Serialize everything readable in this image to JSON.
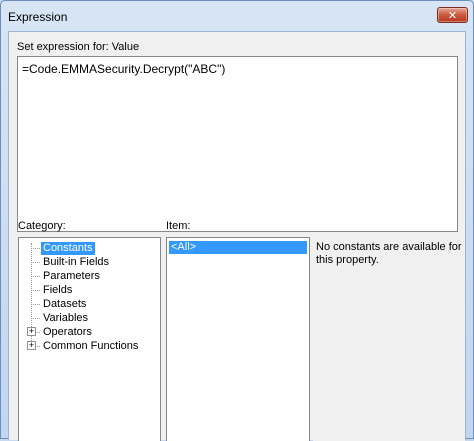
{
  "window": {
    "title": "Expression",
    "close_symbol": "✕"
  },
  "expression": {
    "label": "Set expression for: Value",
    "value": "=Code.EMMASecurity.Decrypt(\"ABC\")"
  },
  "category": {
    "label": "Category:",
    "items": [
      {
        "label": "Constants",
        "selected": true,
        "expandable": false
      },
      {
        "label": "Built-in Fields",
        "selected": false,
        "expandable": false
      },
      {
        "label": "Parameters",
        "selected": false,
        "expandable": false
      },
      {
        "label": "Fields",
        "selected": false,
        "expandable": false
      },
      {
        "label": "Datasets",
        "selected": false,
        "expandable": false
      },
      {
        "label": "Variables",
        "selected": false,
        "expandable": false
      },
      {
        "label": "Operators",
        "selected": false,
        "expandable": true
      },
      {
        "label": "Common Functions",
        "selected": false,
        "expandable": true
      }
    ],
    "expander_symbol": "+"
  },
  "item": {
    "label": "Item:",
    "items": [
      {
        "label": "<All>",
        "selected": true
      }
    ]
  },
  "description": {
    "text": "No constants are available for this property."
  }
}
